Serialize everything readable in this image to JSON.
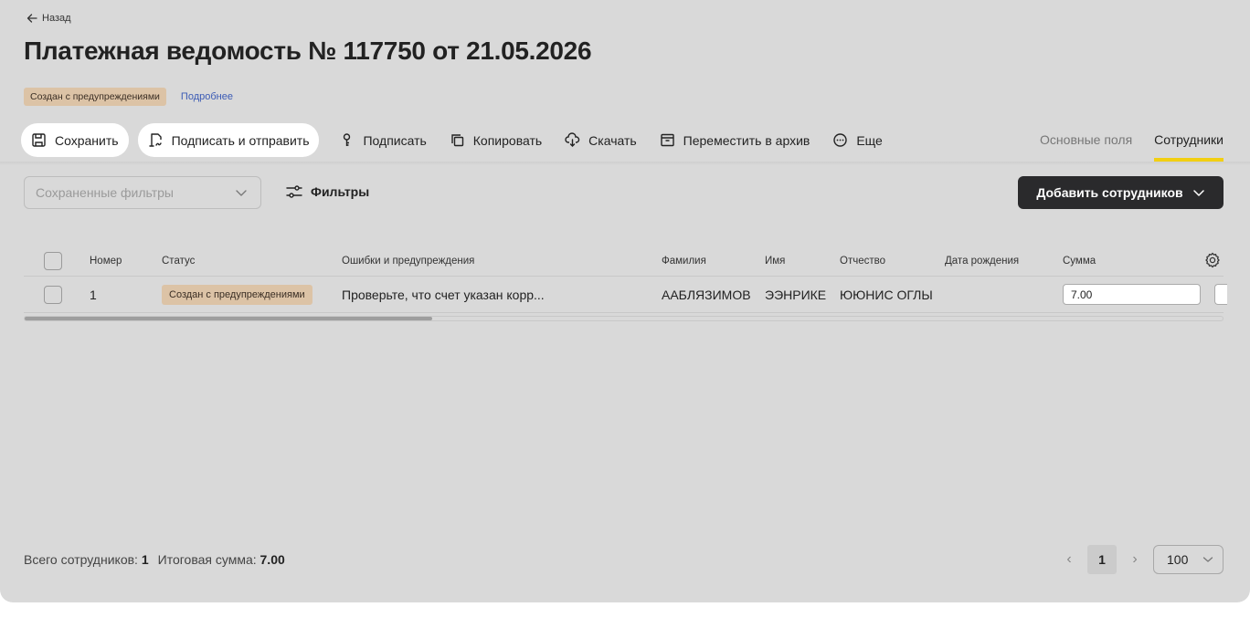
{
  "header": {
    "back_label": "Назад",
    "title": "Платежная ведомость № 117750 от 21.05.2026",
    "status_badge": "Создан с предупреждениями",
    "details_link": "Подробнее"
  },
  "toolbar": {
    "save": "Сохранить",
    "sign_send": "Подписать и отправить",
    "sign": "Подписать",
    "copy": "Копировать",
    "download": "Скачать",
    "archive": "Переместить в архив",
    "more": "Еще"
  },
  "tabs": [
    {
      "label": "Основные поля",
      "active": false
    },
    {
      "label": "Сотрудники",
      "active": true
    }
  ],
  "filters": {
    "saved_placeholder": "Сохраненные фильтры",
    "filters_label": "Фильтры",
    "add_employees": "Добавить сотрудников"
  },
  "table": {
    "columns": [
      "Номер",
      "Статус",
      "Ошибки и предупреждения",
      "Фамилия",
      "Имя",
      "Отчество",
      "Дата рождения",
      "Сумма"
    ],
    "rows": [
      {
        "number": "1",
        "status": "Создан с предупреждениями",
        "errors": "Проверьте, что счет указан корр...",
        "last_name": "ААБЛЯЗИМОВ",
        "first_name": "ЭЭНРИКЕ",
        "patronymic": "ЮЮНИС ОГЛЫ",
        "birth_date": "",
        "sum": "7.00"
      }
    ]
  },
  "footer": {
    "total_label": "Всего сотрудников:",
    "total_value": "1",
    "sum_label": "Итоговая сумма:",
    "sum_value": "7.00"
  },
  "pagination": {
    "current_page": "1",
    "page_size": "100"
  },
  "colors": {
    "accent_tab": "#f2cf12",
    "badge_bg": "#dcc3a6",
    "primary_button": "#2a2a2c",
    "link": "#3b5bb5"
  }
}
